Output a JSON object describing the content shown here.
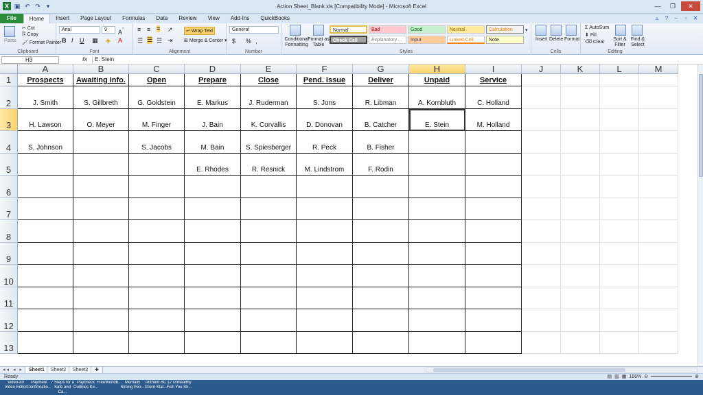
{
  "window": {
    "title": "Action Sheet_Blank.xls  [Compatibility Mode]  -  Microsoft Excel"
  },
  "ribbon_tabs": [
    "File",
    "Home",
    "Insert",
    "Page Layout",
    "Formulas",
    "Data",
    "Review",
    "View",
    "Add-Ins",
    "QuickBooks"
  ],
  "clipboard": {
    "paste": "Paste",
    "cut": "Cut",
    "copy": "Copy",
    "format_painter": "Format Painter",
    "label": "Clipboard"
  },
  "font": {
    "name": "Arial",
    "size": "9",
    "label": "Font"
  },
  "alignment": {
    "wrap": "Wrap Text",
    "merge": "Merge & Center",
    "label": "Alignment"
  },
  "number": {
    "format": "General",
    "label": "Number",
    "currency": "$",
    "percent": "%",
    "comma": ","
  },
  "styles": {
    "conditional": "Conditional Formatting",
    "format_table": "Format as Table",
    "normal": "Normal",
    "bad": "Bad",
    "good": "Good",
    "neutral": "Neutral",
    "calculation": "Calculation",
    "check_cell": "Check Cell",
    "explanatory": "Explanatory ...",
    "input": "Input",
    "linked_cell": "Linked Cell",
    "note": "Note",
    "label": "Styles"
  },
  "cells_group": {
    "insert": "Insert",
    "delete": "Delete",
    "format": "Format",
    "label": "Cells"
  },
  "editing": {
    "autosum": "AutoSum",
    "fill": "Fill",
    "clear": "Clear",
    "sort": "Sort & Filter",
    "find": "Find & Select",
    "label": "Editing"
  },
  "formula_bar": {
    "name_box": "H3",
    "fx": "fx",
    "value": "E. Stein"
  },
  "columns": [
    "A",
    "B",
    "C",
    "D",
    "E",
    "F",
    "G",
    "H",
    "I",
    "J",
    "K",
    "L",
    "M"
  ],
  "selected_column": "H",
  "rows": [
    "1",
    "2",
    "3",
    "4",
    "5",
    "6",
    "7",
    "8",
    "9",
    "10",
    "11",
    "12",
    "13"
  ],
  "selected_row": "3",
  "headers": [
    "Prospects",
    "Awaiting Info.",
    "Open",
    "Prepare",
    "Close",
    "Pend. Issue",
    "Deliver",
    "Unpaid",
    "Service"
  ],
  "data": [
    [
      "J. Smith",
      "S. Gillbreth",
      "G. Goldstein",
      "E. Markus",
      "J. Ruderman",
      "S. Jons",
      "R. Libman",
      "A. Kornbluth",
      "C. Holland"
    ],
    [
      "H. Lawson",
      "O. Meyer",
      "M. Finger",
      "J. Bain",
      "K. Corvallis",
      "D. Donovan",
      "B. Catcher",
      "E. Stein",
      "M. Holland"
    ],
    [
      "S. Johnson",
      "",
      "S. Jacobs",
      "M. Bain",
      "S. Spiesberger",
      "R. Peck",
      "B. Fisher",
      "",
      ""
    ],
    [
      "",
      "",
      "",
      "E. Rhodes",
      "R. Resnick",
      "M. Lindstrom",
      "F. Rodin",
      "",
      ""
    ]
  ],
  "sheets": [
    "Sheet1",
    "Sheet2",
    "Sheet3"
  ],
  "status": {
    "text": "Ready",
    "zoom": "166%"
  },
  "taskbar": [
    "Video-80 Video Editor",
    "Payment Confirmatio...",
    "7 Steps for a Safe and Ca...",
    "Paycheck Outlines Ke...",
    "FreeWorldb...",
    "Mentally Strong Peo...",
    "Anthem BC Client Stat...",
    "12 Unhealthy Fish You Sh..."
  ]
}
